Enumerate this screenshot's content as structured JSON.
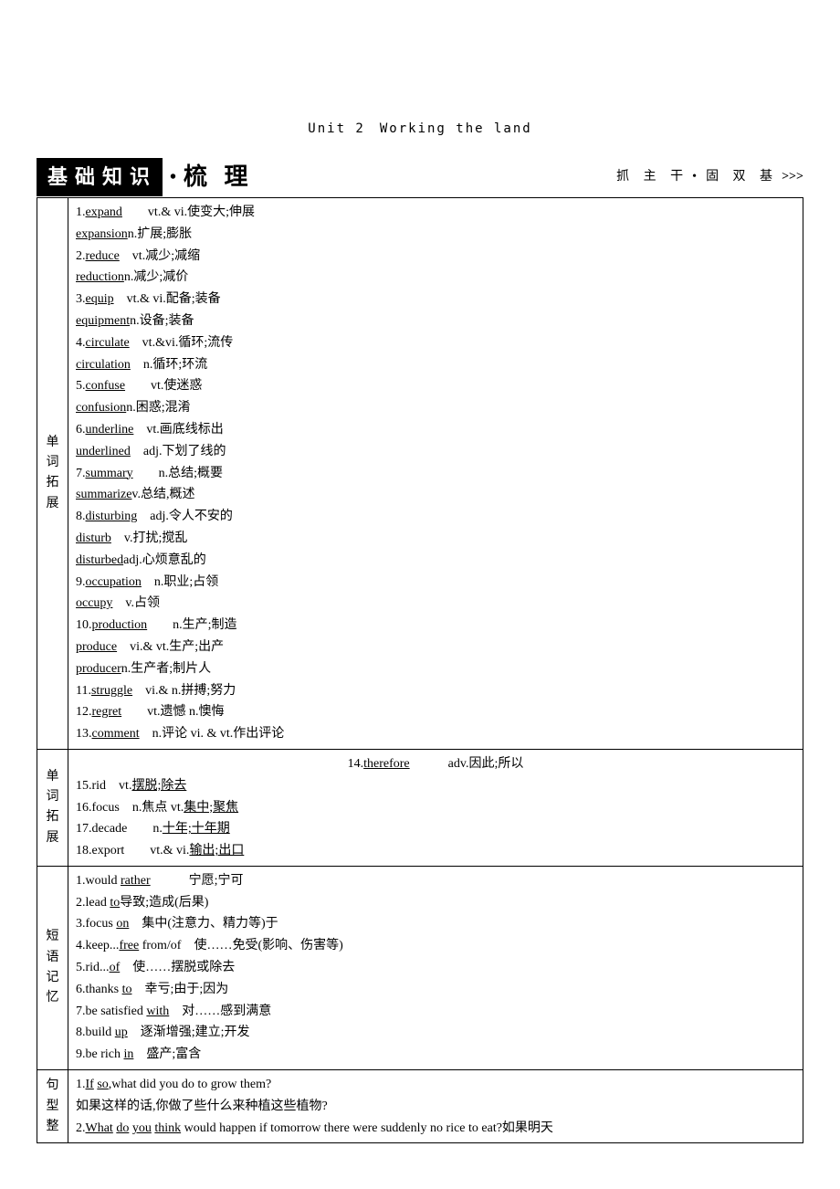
{
  "unit_title": "Unit 2　Working the land",
  "header": {
    "title_black": "基础知识",
    "title_cursive": "梳 理",
    "right_a": "抓 主 干",
    "right_b": "固 双 基",
    "chev": ">>>"
  },
  "sections": {
    "vocab1": {
      "label": "单词拓展",
      "lines": [
        {
          "parts": [
            {
              "t": "1."
            },
            {
              "t": "expand",
              "u": 1
            },
            {
              "t": "　　vt.& vi.使变大;伸展"
            }
          ]
        },
        {
          "parts": [
            {
              "t": "expansion",
              "u": 1
            },
            {
              "t": "n.扩展;膨胀"
            }
          ]
        },
        {
          "parts": [
            {
              "t": "2."
            },
            {
              "t": "reduce",
              "u": 1
            },
            {
              "t": "　vt.减少;减缩"
            }
          ]
        },
        {
          "parts": [
            {
              "t": "reduction",
              "u": 1
            },
            {
              "t": "n.减少;减价"
            }
          ]
        },
        {
          "parts": [
            {
              "t": "3."
            },
            {
              "t": "equip",
              "u": 1
            },
            {
              "t": "　vt.& vi.配备;装备"
            }
          ]
        },
        {
          "parts": [
            {
              "t": "equipment",
              "u": 1
            },
            {
              "t": "n.设备;装备"
            }
          ]
        },
        {
          "parts": [
            {
              "t": "4."
            },
            {
              "t": "circulate",
              "u": 1
            },
            {
              "t": "　vt.&vi.循环;流传"
            }
          ]
        },
        {
          "parts": [
            {
              "t": "circulation",
              "u": 1
            },
            {
              "t": "　n.循环;环流"
            }
          ]
        },
        {
          "parts": [
            {
              "t": "5."
            },
            {
              "t": "confuse",
              "u": 1
            },
            {
              "t": "　　vt.使迷惑"
            }
          ]
        },
        {
          "parts": [
            {
              "t": "confusion",
              "u": 1
            },
            {
              "t": "n.困惑;混淆"
            }
          ]
        },
        {
          "parts": [
            {
              "t": "6."
            },
            {
              "t": "underline",
              "u": 1
            },
            {
              "t": "　vt.画底线标出"
            }
          ]
        },
        {
          "parts": [
            {
              "t": "underlined",
              "u": 1
            },
            {
              "t": "　adj.下划了线的"
            }
          ]
        },
        {
          "parts": [
            {
              "t": "7."
            },
            {
              "t": "summary",
              "u": 1
            },
            {
              "t": "　　n.总结;概要"
            }
          ]
        },
        {
          "parts": [
            {
              "t": "summarize",
              "u": 1
            },
            {
              "t": "v.总结,概述"
            }
          ]
        },
        {
          "parts": [
            {
              "t": "8."
            },
            {
              "t": "disturbing",
              "u": 1
            },
            {
              "t": "　adj.令人不安的"
            }
          ]
        },
        {
          "parts": [
            {
              "t": "disturb",
              "u": 1
            },
            {
              "t": "　v.打扰;搅乱"
            }
          ]
        },
        {
          "parts": [
            {
              "t": "disturbed",
              "u": 1
            },
            {
              "t": "adj.心烦意乱的"
            }
          ]
        },
        {
          "parts": [
            {
              "t": "9."
            },
            {
              "t": "occupation",
              "u": 1
            },
            {
              "t": "　n.职业;占领"
            }
          ]
        },
        {
          "parts": [
            {
              "t": "occupy",
              "u": 1
            },
            {
              "t": "　v.占领"
            }
          ]
        },
        {
          "parts": [
            {
              "t": "10."
            },
            {
              "t": "production",
              "u": 1
            },
            {
              "t": "　　n.生产;制造"
            }
          ]
        },
        {
          "parts": [
            {
              "t": "produce",
              "u": 1
            },
            {
              "t": "　vi.& vt.生产;出产"
            }
          ]
        },
        {
          "parts": [
            {
              "t": "producer",
              "u": 1
            },
            {
              "t": "n.生产者;制片人"
            }
          ]
        },
        {
          "parts": [
            {
              "t": "11."
            },
            {
              "t": "struggle",
              "u": 1
            },
            {
              "t": "　vi.& n.拼搏;努力"
            }
          ]
        },
        {
          "parts": [
            {
              "t": "12."
            },
            {
              "t": "regret",
              "u": 1
            },
            {
              "t": "　　vt.遗憾 n.懊悔"
            }
          ]
        },
        {
          "parts": [
            {
              "t": "13."
            },
            {
              "t": "comment",
              "u": 1
            },
            {
              "t": "　n.评论 vi. & vt.作出评论"
            }
          ]
        }
      ]
    },
    "vocab2": {
      "label": "单词拓展",
      "lines": [
        {
          "center": true,
          "parts": [
            {
              "t": "14."
            },
            {
              "t": "therefore",
              "u": 1
            },
            {
              "t": "　　　adv.因此;所以"
            }
          ]
        },
        {
          "parts": [
            {
              "t": "15.rid　vt."
            },
            {
              "t": "摆脱;除去",
              "u": 1
            }
          ]
        },
        {
          "parts": [
            {
              "t": "16.focus　n.焦点 vt."
            },
            {
              "t": "集中;聚焦",
              "u": 1
            }
          ]
        },
        {
          "parts": [
            {
              "t": "17.decade　　n."
            },
            {
              "t": "十年;十年期",
              "u": 1
            }
          ]
        },
        {
          "parts": [
            {
              "t": "18.export　　vt.& vi."
            },
            {
              "t": "输出;出口",
              "u": 1
            }
          ]
        }
      ]
    },
    "phrases": {
      "label": "短语记忆",
      "lines": [
        {
          "parts": [
            {
              "t": "1.would "
            },
            {
              "t": "rather",
              "u": 1
            },
            {
              "t": "　　　宁愿;宁可"
            }
          ]
        },
        {
          "parts": [
            {
              "t": "2.lead "
            },
            {
              "t": "to",
              "u": 1
            },
            {
              "t": "导致;造成(后果)"
            }
          ]
        },
        {
          "parts": [
            {
              "t": "3.focus "
            },
            {
              "t": "on",
              "u": 1
            },
            {
              "t": "　集中(注意力、精力等)于"
            }
          ]
        },
        {
          "parts": [
            {
              "t": "4.keep..."
            },
            {
              "t": "free",
              "u": 1
            },
            {
              "t": " from/of　使……免受(影响、伤害等)"
            }
          ]
        },
        {
          "parts": [
            {
              "t": "5.rid..."
            },
            {
              "t": "of",
              "u": 1
            },
            {
              "t": "　使……摆脱或除去"
            }
          ]
        },
        {
          "parts": [
            {
              "t": "6.thanks "
            },
            {
              "t": "to",
              "u": 1
            },
            {
              "t": "　幸亏;由于;因为"
            }
          ]
        },
        {
          "parts": [
            {
              "t": "7.be satisfied "
            },
            {
              "t": "with",
              "u": 1
            },
            {
              "t": "　对……感到满意"
            }
          ]
        },
        {
          "parts": [
            {
              "t": "8.build "
            },
            {
              "t": "up",
              "u": 1
            },
            {
              "t": "　逐渐增强;建立;开发"
            }
          ]
        },
        {
          "parts": [
            {
              "t": "9.be rich "
            },
            {
              "t": "in",
              "u": 1
            },
            {
              "t": "　盛产;富含"
            }
          ]
        }
      ]
    },
    "sentences": {
      "label": "句型整",
      "lines": [
        {
          "parts": [
            {
              "t": "1."
            },
            {
              "t": "If",
              "u": 1
            },
            {
              "t": " "
            },
            {
              "t": "so",
              "u": 1
            },
            {
              "t": ",what did you do to grow them?"
            }
          ]
        },
        {
          "parts": [
            {
              "t": "如果这样的话,你做了些什么来种植这些植物?"
            }
          ]
        },
        {
          "parts": [
            {
              "t": "2."
            },
            {
              "t": "What",
              "u": 1
            },
            {
              "t": " "
            },
            {
              "t": "do",
              "u": 1
            },
            {
              "t": " "
            },
            {
              "t": "you",
              "u": 1
            },
            {
              "t": " "
            },
            {
              "t": "think",
              "u": 1
            },
            {
              "t": " would happen if tomorrow there were suddenly no rice to eat?如果明天"
            }
          ]
        }
      ]
    }
  }
}
